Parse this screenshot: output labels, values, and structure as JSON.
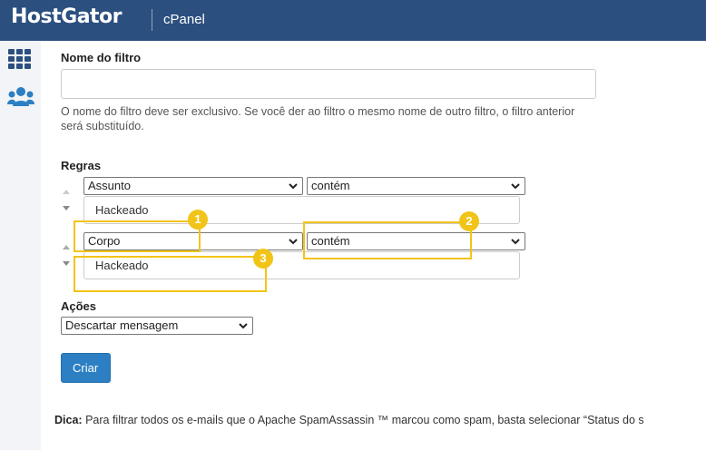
{
  "header": {
    "brand": "HostGator",
    "product": "cPanel"
  },
  "sidebar": {
    "items": [
      {
        "icon": "grid-icon",
        "label": ""
      },
      {
        "icon": "users-icon",
        "label": ""
      }
    ]
  },
  "form": {
    "filter_name": {
      "label": "Nome do filtro",
      "value": "",
      "placeholder": ""
    },
    "filter_name_help": "O nome do filtro deve ser exclusivo. Se você der ao filtro o mesmo nome de outro filtro, o filtro anterior será substituído.",
    "rules_label": "Regras",
    "rules": [
      {
        "field": "Assunto",
        "operator": "contém",
        "value": "Hackeado"
      },
      {
        "field": "Corpo",
        "operator": "contém",
        "value": "Hackeado"
      }
    ],
    "actions_label": "Ações",
    "action_select": "Descartar mensagem",
    "submit_label": "Criar"
  },
  "annotations": [
    "1",
    "2",
    "3"
  ],
  "tip": {
    "prefix": "Dica:",
    "text": "Para filtrar todos os e-mails que o Apache SpamAssassin ™ marcou como spam, basta selecionar “Status do s"
  },
  "colors": {
    "header": "#2b4f7f",
    "accent": "#2c7fc3",
    "highlight": "#f2c418"
  }
}
